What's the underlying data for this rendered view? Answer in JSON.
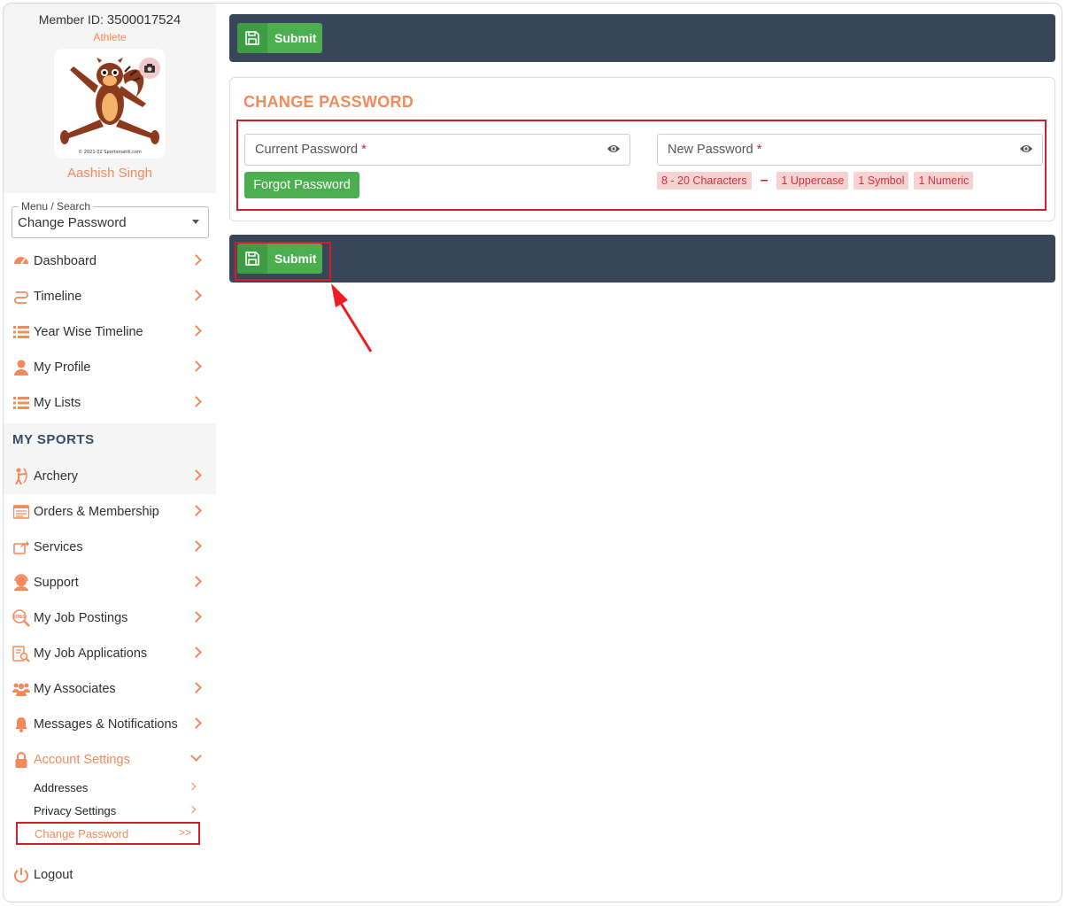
{
  "sidebar": {
    "member_id_label": "Member ID:",
    "member_id": "3500017524",
    "role": "Athlete",
    "user_name": "Aashish Singh",
    "menu_search": {
      "legend": "Menu / Search",
      "value": "Change Password"
    },
    "items": [
      {
        "label": "Dashboard",
        "icon": "dashboard-icon"
      },
      {
        "label": "Timeline",
        "icon": "timeline-icon"
      },
      {
        "label": "Year Wise Timeline",
        "icon": "list-icon"
      },
      {
        "label": "My Profile",
        "icon": "user-icon"
      },
      {
        "label": "My Lists",
        "icon": "list-icon"
      }
    ],
    "section_title": "MY SPORTS",
    "sports_items": [
      {
        "label": "Archery",
        "icon": "archery-icon"
      },
      {
        "label": "Orders & Membership",
        "icon": "orders-icon"
      },
      {
        "label": "Services",
        "icon": "share-icon"
      },
      {
        "label": "Support",
        "icon": "headset-icon"
      },
      {
        "label": "My Job Postings",
        "icon": "jobs-icon"
      },
      {
        "label": "My Job Applications",
        "icon": "application-icon"
      },
      {
        "label": "My Associates",
        "icon": "users-icon"
      },
      {
        "label": "Messages & Notifications",
        "icon": "bell-icon"
      },
      {
        "label": "Account Settings",
        "icon": "lock-icon"
      }
    ],
    "account_sub": [
      {
        "label": "Addresses"
      },
      {
        "label": "Privacy Settings"
      },
      {
        "label": "Change Password"
      }
    ],
    "logout": "Logout",
    "avatar_caption": "© 2021-22 Sportsmatik.com"
  },
  "main": {
    "submit_label": "Submit",
    "card_title": "CHANGE PASSWORD",
    "current_password": {
      "placeholder": "Current Password",
      "required_mark": "*"
    },
    "new_password": {
      "placeholder": "New Password",
      "required_mark": "*"
    },
    "forgot_label": "Forgot Password",
    "rules": [
      "8 - 20 Characters",
      "1 Uppercase",
      "1 Symbol",
      "1 Numeric"
    ],
    "rule_separator": "–"
  },
  "colors": {
    "accent": "#f28a5c",
    "green": "#4bae4f",
    "dark_bar": "#394659",
    "highlight_red": "#d21e2b"
  }
}
